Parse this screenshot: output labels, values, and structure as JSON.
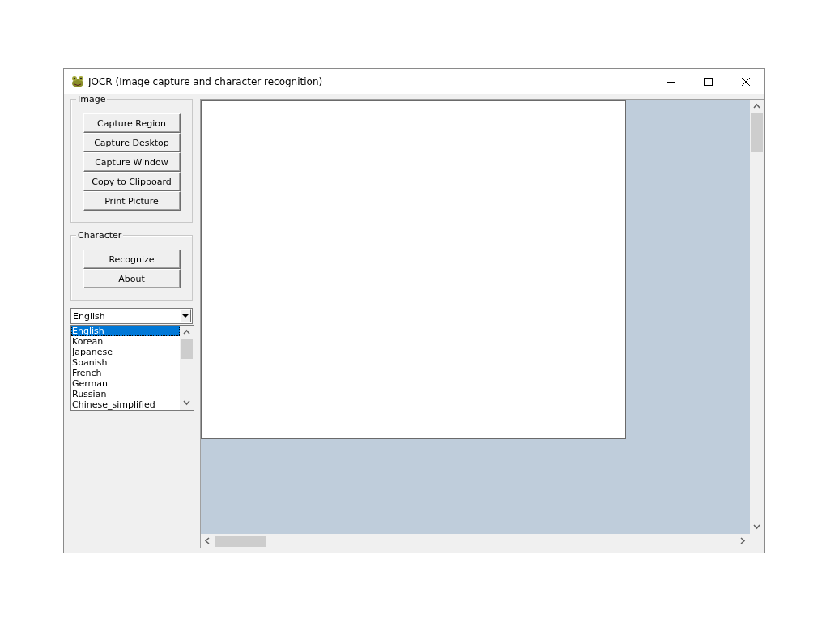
{
  "window": {
    "title": "JOCR (Image capture and character recognition)"
  },
  "image_group": {
    "title": "Image",
    "buttons": [
      "Capture Region",
      "Capture Desktop",
      "Capture Window",
      "Copy to Clipboard",
      "Print Picture"
    ]
  },
  "character_group": {
    "title": "Character",
    "buttons": [
      "Recognize",
      "About"
    ]
  },
  "language_combo": {
    "value": "English"
  },
  "language_list": [
    {
      "label": "English",
      "selected": true
    },
    {
      "label": "Korean",
      "selected": false
    },
    {
      "label": "Japanese",
      "selected": false
    },
    {
      "label": "Spanish",
      "selected": false
    },
    {
      "label": "French",
      "selected": false
    },
    {
      "label": "German",
      "selected": false
    },
    {
      "label": "Russian",
      "selected": false
    },
    {
      "label": "Chinese_simplified",
      "selected": false
    }
  ]
}
